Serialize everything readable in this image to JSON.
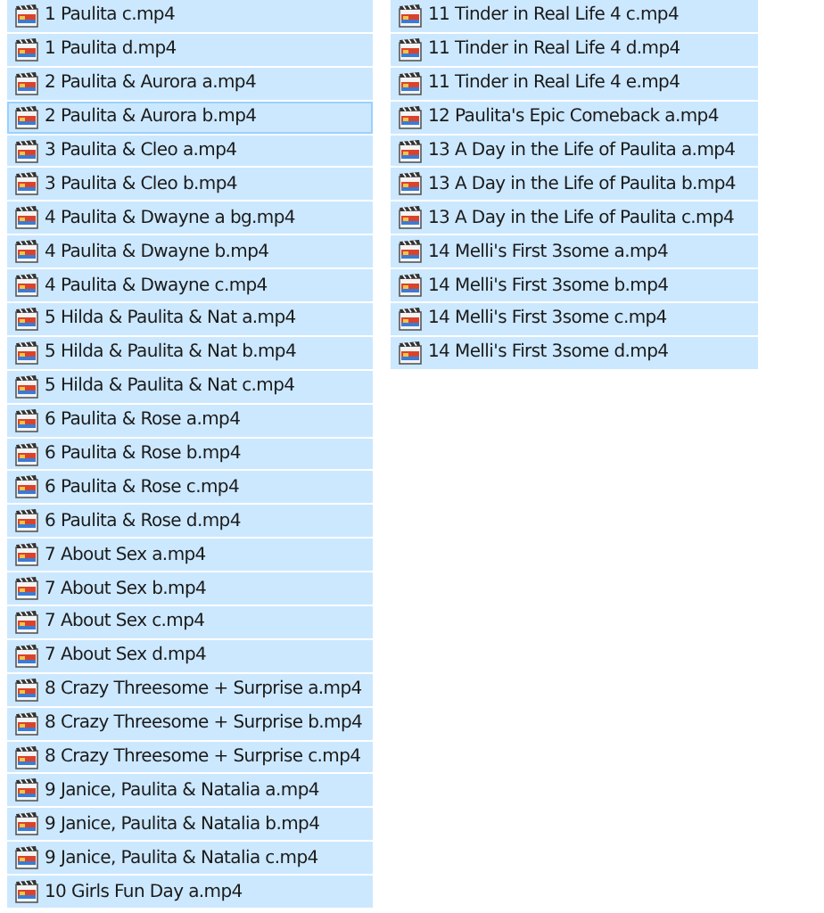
{
  "columns": [
    {
      "files": [
        {
          "name": "1 Paulita c.mp4",
          "selected": true,
          "focused": false
        },
        {
          "name": "1 Paulita d.mp4",
          "selected": true,
          "focused": false
        },
        {
          "name": "2 Paulita & Aurora a.mp4",
          "selected": true,
          "focused": false
        },
        {
          "name": "2 Paulita & Aurora b.mp4",
          "selected": true,
          "focused": true
        },
        {
          "name": "3 Paulita & Cleo a.mp4",
          "selected": true,
          "focused": false
        },
        {
          "name": "3 Paulita & Cleo b.mp4",
          "selected": true,
          "focused": false
        },
        {
          "name": "4 Paulita & Dwayne a bg.mp4",
          "selected": true,
          "focused": false
        },
        {
          "name": "4 Paulita & Dwayne b.mp4",
          "selected": true,
          "focused": false
        },
        {
          "name": "4 Paulita & Dwayne c.mp4",
          "selected": true,
          "focused": false
        },
        {
          "name": "5 Hilda & Paulita & Nat a.mp4",
          "selected": true,
          "focused": false
        },
        {
          "name": "5 Hilda & Paulita & Nat b.mp4",
          "selected": true,
          "focused": false
        },
        {
          "name": "5 Hilda & Paulita & Nat c.mp4",
          "selected": true,
          "focused": false
        },
        {
          "name": "6 Paulita & Rose a.mp4",
          "selected": true,
          "focused": false
        },
        {
          "name": "6 Paulita & Rose b.mp4",
          "selected": true,
          "focused": false
        },
        {
          "name": "6 Paulita & Rose c.mp4",
          "selected": true,
          "focused": false
        },
        {
          "name": "6 Paulita & Rose d.mp4",
          "selected": true,
          "focused": false
        },
        {
          "name": "7 About Sex a.mp4",
          "selected": true,
          "focused": false
        },
        {
          "name": "7 About Sex b.mp4",
          "selected": true,
          "focused": false
        },
        {
          "name": "7 About Sex c.mp4",
          "selected": true,
          "focused": false
        },
        {
          "name": "7 About Sex d.mp4",
          "selected": true,
          "focused": false
        },
        {
          "name": "8 Crazy Threesome + Surprise a.mp4",
          "selected": true,
          "focused": false
        },
        {
          "name": "8 Crazy Threesome + Surprise b.mp4",
          "selected": true,
          "focused": false
        },
        {
          "name": "8 Crazy Threesome + Surprise c.mp4",
          "selected": true,
          "focused": false
        },
        {
          "name": "9 Janice, Paulita & Natalia a.mp4",
          "selected": true,
          "focused": false
        },
        {
          "name": "9 Janice, Paulita & Natalia b.mp4",
          "selected": true,
          "focused": false
        },
        {
          "name": "9 Janice, Paulita & Natalia c.mp4",
          "selected": true,
          "focused": false
        },
        {
          "name": "10 Girls Fun Day a.mp4",
          "selected": true,
          "focused": false
        }
      ]
    },
    {
      "files": [
        {
          "name": "11 Tinder in Real Life 4 c.mp4",
          "selected": true,
          "focused": false
        },
        {
          "name": "11 Tinder in Real Life 4 d.mp4",
          "selected": true,
          "focused": false
        },
        {
          "name": "11 Tinder in Real Life 4 e.mp4",
          "selected": true,
          "focused": false
        },
        {
          "name": "12 Paulita's Epic Comeback a.mp4",
          "selected": true,
          "focused": false
        },
        {
          "name": "13 A Day in the Life of Paulita a.mp4",
          "selected": true,
          "focused": false
        },
        {
          "name": "13 A Day in the Life of Paulita b.mp4",
          "selected": true,
          "focused": false
        },
        {
          "name": "13 A Day in the Life of Paulita c.mp4",
          "selected": true,
          "focused": false
        },
        {
          "name": "14 Melli's First 3some a.mp4",
          "selected": true,
          "focused": false
        },
        {
          "name": "14 Melli's First 3some b.mp4",
          "selected": true,
          "focused": false
        },
        {
          "name": "14 Melli's First 3some c.mp4",
          "selected": true,
          "focused": false
        },
        {
          "name": "14 Melli's First 3some d.mp4",
          "selected": true,
          "focused": false
        }
      ]
    }
  ]
}
